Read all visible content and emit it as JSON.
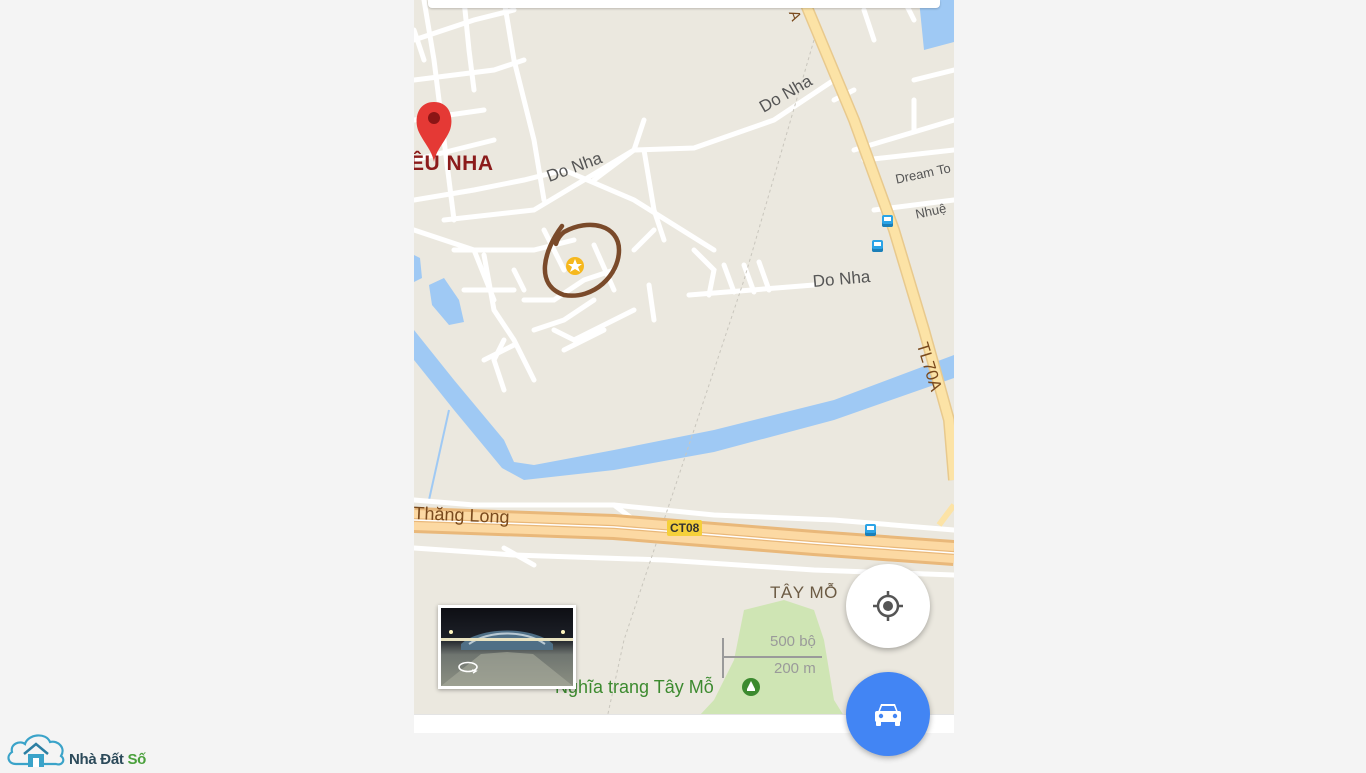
{
  "map": {
    "place_label": "ÊU NHA",
    "road_labels": {
      "do_nha_1": "Do Nha",
      "do_nha_2": "Do Nha",
      "do_nha_3": "Do Nha",
      "tl70a_top": "A",
      "tl70a": "TL70A",
      "thang_long": "Thăng Long"
    },
    "poi_labels": {
      "dream": "Dream To",
      "nhue": "Nhuệ",
      "tay_mo": "TÂY MỖ",
      "cemetery": "Nghĩa trang Tây Mỗ"
    },
    "route_shield": "CT08",
    "scale": {
      "imperial": "500 bộ",
      "metric": "200 m"
    },
    "colors": {
      "land": "#ebe8df",
      "water": "#9fc9f4",
      "highway": "#f7cf8e",
      "park": "#cfe5b4",
      "marker": "#e53935",
      "annotation_circle": "#7a4a2a",
      "accent_blue": "#4285f4"
    },
    "icons": {
      "place_marker": "red-map-pin-icon",
      "starred_place": "star-marker-icon",
      "bus_stop": "bus-icon",
      "cemetery": "cemetery-icon",
      "locate": "my-location-icon",
      "directions": "car-icon",
      "street_view": "360-rotate-icon"
    }
  },
  "watermark": {
    "part1": "Nhà Đất ",
    "part2": "Số"
  }
}
